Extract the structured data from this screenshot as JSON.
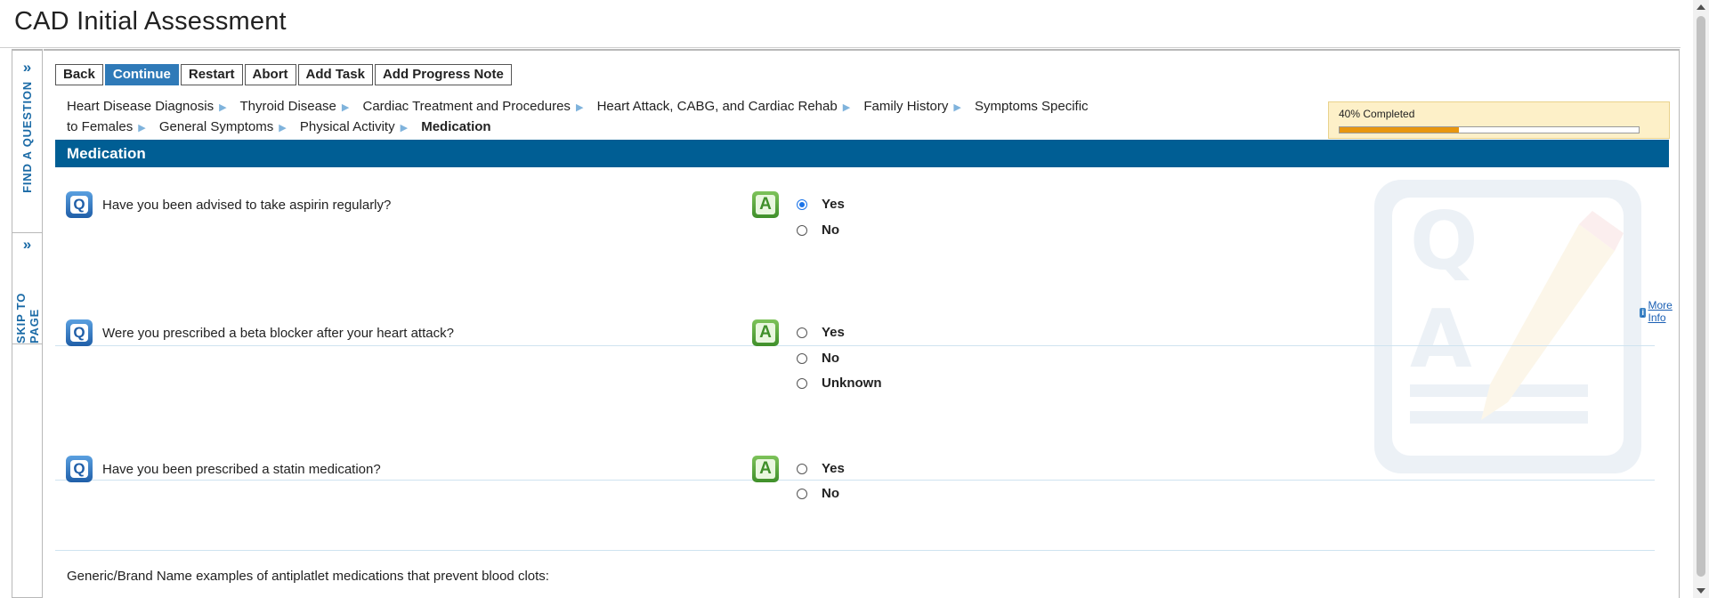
{
  "page": {
    "title": "CAD Initial Assessment"
  },
  "side_tabs": {
    "find_question": "FIND A QUESTION",
    "skip_to_page": "SKIP TO PAGE",
    "chevron": "»"
  },
  "toolbar": {
    "back": "Back",
    "continue": "Continue",
    "restart": "Restart",
    "abort": "Abort",
    "add_task": "Add Task",
    "add_progress_note": "Add Progress Note"
  },
  "breadcrumbs": [
    "Heart Disease Diagnosis",
    "Thyroid Disease",
    "Cardiac Treatment and Procedures",
    "Heart Attack, CABG, and Cardiac Rehab",
    "Family History",
    "Symptoms Specific to Females",
    "General Symptoms",
    "Physical Activity",
    "Medication"
  ],
  "progress": {
    "label": "40% Completed",
    "fraction": 0.4,
    "color": "#e8960e"
  },
  "section": {
    "title": "Medication",
    "color": "#005e94"
  },
  "questions": [
    {
      "text": "Have you been advised to take aspirin regularly?",
      "options": [
        {
          "label": "Yes",
          "checked": true
        },
        {
          "label": "No",
          "checked": false
        }
      ]
    },
    {
      "text": "Were you prescribed a beta blocker after your heart attack?",
      "options": [
        {
          "label": "Yes",
          "checked": false
        },
        {
          "label": "No",
          "checked": false
        },
        {
          "label": "Unknown",
          "checked": false
        }
      ]
    },
    {
      "text": "Have you been prescribed a statin medication?",
      "options": [
        {
          "label": "Yes",
          "checked": false
        },
        {
          "label": "No",
          "checked": false
        }
      ]
    }
  ],
  "icons": {
    "question": "Q",
    "answer": "A",
    "info": "i"
  },
  "more_info": "More Info",
  "generic_note": "Generic/Brand Name examples of antiplatlet medications that prevent blood clots:"
}
